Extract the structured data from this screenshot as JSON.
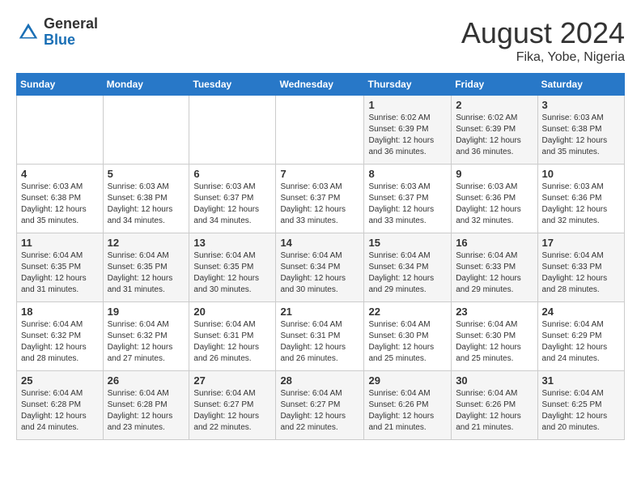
{
  "logo": {
    "general": "General",
    "blue": "Blue"
  },
  "title": {
    "month_year": "August 2024",
    "location": "Fika, Yobe, Nigeria"
  },
  "weekdays": [
    "Sunday",
    "Monday",
    "Tuesday",
    "Wednesday",
    "Thursday",
    "Friday",
    "Saturday"
  ],
  "weeks": [
    [
      {
        "day": "",
        "sunrise": "",
        "sunset": "",
        "daylight": ""
      },
      {
        "day": "",
        "sunrise": "",
        "sunset": "",
        "daylight": ""
      },
      {
        "day": "",
        "sunrise": "",
        "sunset": "",
        "daylight": ""
      },
      {
        "day": "",
        "sunrise": "",
        "sunset": "",
        "daylight": ""
      },
      {
        "day": "1",
        "sunrise": "Sunrise: 6:02 AM",
        "sunset": "Sunset: 6:39 PM",
        "daylight": "Daylight: 12 hours and 36 minutes."
      },
      {
        "day": "2",
        "sunrise": "Sunrise: 6:02 AM",
        "sunset": "Sunset: 6:39 PM",
        "daylight": "Daylight: 12 hours and 36 minutes."
      },
      {
        "day": "3",
        "sunrise": "Sunrise: 6:03 AM",
        "sunset": "Sunset: 6:38 PM",
        "daylight": "Daylight: 12 hours and 35 minutes."
      }
    ],
    [
      {
        "day": "4",
        "sunrise": "Sunrise: 6:03 AM",
        "sunset": "Sunset: 6:38 PM",
        "daylight": "Daylight: 12 hours and 35 minutes."
      },
      {
        "day": "5",
        "sunrise": "Sunrise: 6:03 AM",
        "sunset": "Sunset: 6:38 PM",
        "daylight": "Daylight: 12 hours and 34 minutes."
      },
      {
        "day": "6",
        "sunrise": "Sunrise: 6:03 AM",
        "sunset": "Sunset: 6:37 PM",
        "daylight": "Daylight: 12 hours and 34 minutes."
      },
      {
        "day": "7",
        "sunrise": "Sunrise: 6:03 AM",
        "sunset": "Sunset: 6:37 PM",
        "daylight": "Daylight: 12 hours and 33 minutes."
      },
      {
        "day": "8",
        "sunrise": "Sunrise: 6:03 AM",
        "sunset": "Sunset: 6:37 PM",
        "daylight": "Daylight: 12 hours and 33 minutes."
      },
      {
        "day": "9",
        "sunrise": "Sunrise: 6:03 AM",
        "sunset": "Sunset: 6:36 PM",
        "daylight": "Daylight: 12 hours and 32 minutes."
      },
      {
        "day": "10",
        "sunrise": "Sunrise: 6:03 AM",
        "sunset": "Sunset: 6:36 PM",
        "daylight": "Daylight: 12 hours and 32 minutes."
      }
    ],
    [
      {
        "day": "11",
        "sunrise": "Sunrise: 6:04 AM",
        "sunset": "Sunset: 6:35 PM",
        "daylight": "Daylight: 12 hours and 31 minutes."
      },
      {
        "day": "12",
        "sunrise": "Sunrise: 6:04 AM",
        "sunset": "Sunset: 6:35 PM",
        "daylight": "Daylight: 12 hours and 31 minutes."
      },
      {
        "day": "13",
        "sunrise": "Sunrise: 6:04 AM",
        "sunset": "Sunset: 6:35 PM",
        "daylight": "Daylight: 12 hours and 30 minutes."
      },
      {
        "day": "14",
        "sunrise": "Sunrise: 6:04 AM",
        "sunset": "Sunset: 6:34 PM",
        "daylight": "Daylight: 12 hours and 30 minutes."
      },
      {
        "day": "15",
        "sunrise": "Sunrise: 6:04 AM",
        "sunset": "Sunset: 6:34 PM",
        "daylight": "Daylight: 12 hours and 29 minutes."
      },
      {
        "day": "16",
        "sunrise": "Sunrise: 6:04 AM",
        "sunset": "Sunset: 6:33 PM",
        "daylight": "Daylight: 12 hours and 29 minutes."
      },
      {
        "day": "17",
        "sunrise": "Sunrise: 6:04 AM",
        "sunset": "Sunset: 6:33 PM",
        "daylight": "Daylight: 12 hours and 28 minutes."
      }
    ],
    [
      {
        "day": "18",
        "sunrise": "Sunrise: 6:04 AM",
        "sunset": "Sunset: 6:32 PM",
        "daylight": "Daylight: 12 hours and 28 minutes."
      },
      {
        "day": "19",
        "sunrise": "Sunrise: 6:04 AM",
        "sunset": "Sunset: 6:32 PM",
        "daylight": "Daylight: 12 hours and 27 minutes."
      },
      {
        "day": "20",
        "sunrise": "Sunrise: 6:04 AM",
        "sunset": "Sunset: 6:31 PM",
        "daylight": "Daylight: 12 hours and 26 minutes."
      },
      {
        "day": "21",
        "sunrise": "Sunrise: 6:04 AM",
        "sunset": "Sunset: 6:31 PM",
        "daylight": "Daylight: 12 hours and 26 minutes."
      },
      {
        "day": "22",
        "sunrise": "Sunrise: 6:04 AM",
        "sunset": "Sunset: 6:30 PM",
        "daylight": "Daylight: 12 hours and 25 minutes."
      },
      {
        "day": "23",
        "sunrise": "Sunrise: 6:04 AM",
        "sunset": "Sunset: 6:30 PM",
        "daylight": "Daylight: 12 hours and 25 minutes."
      },
      {
        "day": "24",
        "sunrise": "Sunrise: 6:04 AM",
        "sunset": "Sunset: 6:29 PM",
        "daylight": "Daylight: 12 hours and 24 minutes."
      }
    ],
    [
      {
        "day": "25",
        "sunrise": "Sunrise: 6:04 AM",
        "sunset": "Sunset: 6:28 PM",
        "daylight": "Daylight: 12 hours and 24 minutes."
      },
      {
        "day": "26",
        "sunrise": "Sunrise: 6:04 AM",
        "sunset": "Sunset: 6:28 PM",
        "daylight": "Daylight: 12 hours and 23 minutes."
      },
      {
        "day": "27",
        "sunrise": "Sunrise: 6:04 AM",
        "sunset": "Sunset: 6:27 PM",
        "daylight": "Daylight: 12 hours and 22 minutes."
      },
      {
        "day": "28",
        "sunrise": "Sunrise: 6:04 AM",
        "sunset": "Sunset: 6:27 PM",
        "daylight": "Daylight: 12 hours and 22 minutes."
      },
      {
        "day": "29",
        "sunrise": "Sunrise: 6:04 AM",
        "sunset": "Sunset: 6:26 PM",
        "daylight": "Daylight: 12 hours and 21 minutes."
      },
      {
        "day": "30",
        "sunrise": "Sunrise: 6:04 AM",
        "sunset": "Sunset: 6:26 PM",
        "daylight": "Daylight: 12 hours and 21 minutes."
      },
      {
        "day": "31",
        "sunrise": "Sunrise: 6:04 AM",
        "sunset": "Sunset: 6:25 PM",
        "daylight": "Daylight: 12 hours and 20 minutes."
      }
    ]
  ]
}
